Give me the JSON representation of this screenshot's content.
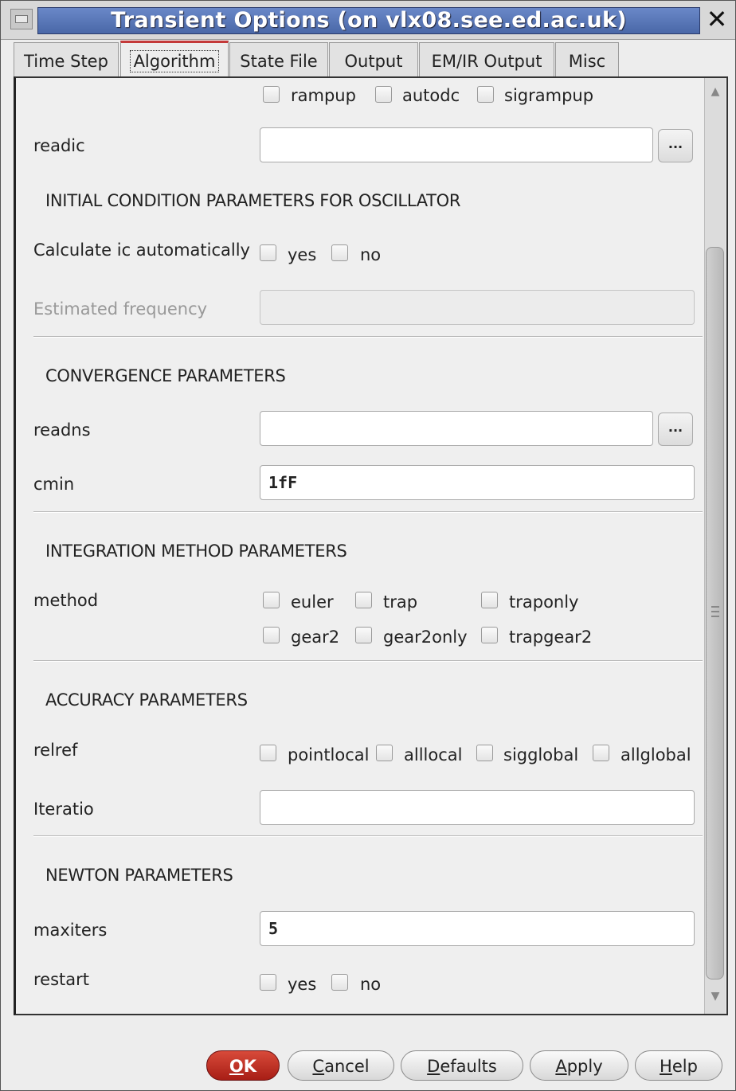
{
  "window": {
    "title": "Transient Options (on vlx08.see.ed.ac.uk)",
    "close_glyph": "✕"
  },
  "tabs": [
    {
      "label": "Time Step",
      "active": false
    },
    {
      "label": "Algorithm",
      "active": true
    },
    {
      "label": "State File",
      "active": false
    },
    {
      "label": "Output",
      "active": false
    },
    {
      "label": "EM/IR Output",
      "active": false
    },
    {
      "label": "Misc",
      "active": false
    }
  ],
  "top_options": [
    {
      "label": "rampup",
      "checked": false
    },
    {
      "label": "autodc",
      "checked": false
    },
    {
      "label": "sigrampup",
      "checked": false
    }
  ],
  "readic": {
    "label": "readic",
    "value": "",
    "browse_label": "..."
  },
  "oscillator": {
    "heading": "INITIAL CONDITION PARAMETERS FOR OSCILLATOR",
    "calc_label": "Calculate ic automatically",
    "calc_options": [
      {
        "label": "yes"
      },
      {
        "label": "no"
      }
    ],
    "freq_label": "Estimated frequency",
    "freq_value": ""
  },
  "convergence": {
    "heading": "CONVERGENCE PARAMETERS",
    "readns_label": "readns",
    "readns_value": "",
    "browse_label": "...",
    "cmin_label": "cmin",
    "cmin_value": "1fF"
  },
  "integration": {
    "heading": "INTEGRATION METHOD PARAMETERS",
    "method_label": "method",
    "options_row1": [
      {
        "label": "euler"
      },
      {
        "label": "trap"
      },
      {
        "label": "traponly"
      }
    ],
    "options_row2": [
      {
        "label": "gear2"
      },
      {
        "label": "gear2only"
      },
      {
        "label": "trapgear2"
      }
    ]
  },
  "accuracy": {
    "heading": "ACCURACY PARAMETERS",
    "relref_label": "relref",
    "relref_options": [
      {
        "label": "pointlocal"
      },
      {
        "label": "alllocal"
      },
      {
        "label": "sigglobal"
      },
      {
        "label": "allglobal"
      }
    ],
    "iteratio_label": "Iteratio",
    "iteratio_value": ""
  },
  "newton": {
    "heading": "NEWTON PARAMETERS",
    "maxiters_label": "maxiters",
    "maxiters_value": "5",
    "restart_label": "restart",
    "restart_options": [
      {
        "label": "yes"
      },
      {
        "label": "no"
      }
    ]
  },
  "buttons": {
    "ok": {
      "u": "O",
      "rest": "K"
    },
    "cancel": {
      "u": "C",
      "rest": "ancel"
    },
    "defaults": {
      "u": "D",
      "rest": "efaults"
    },
    "apply": {
      "u": "A",
      "rest": "pply"
    },
    "help": {
      "u": "H",
      "rest": "elp"
    }
  },
  "scrollbar": {
    "position": 0.85
  }
}
